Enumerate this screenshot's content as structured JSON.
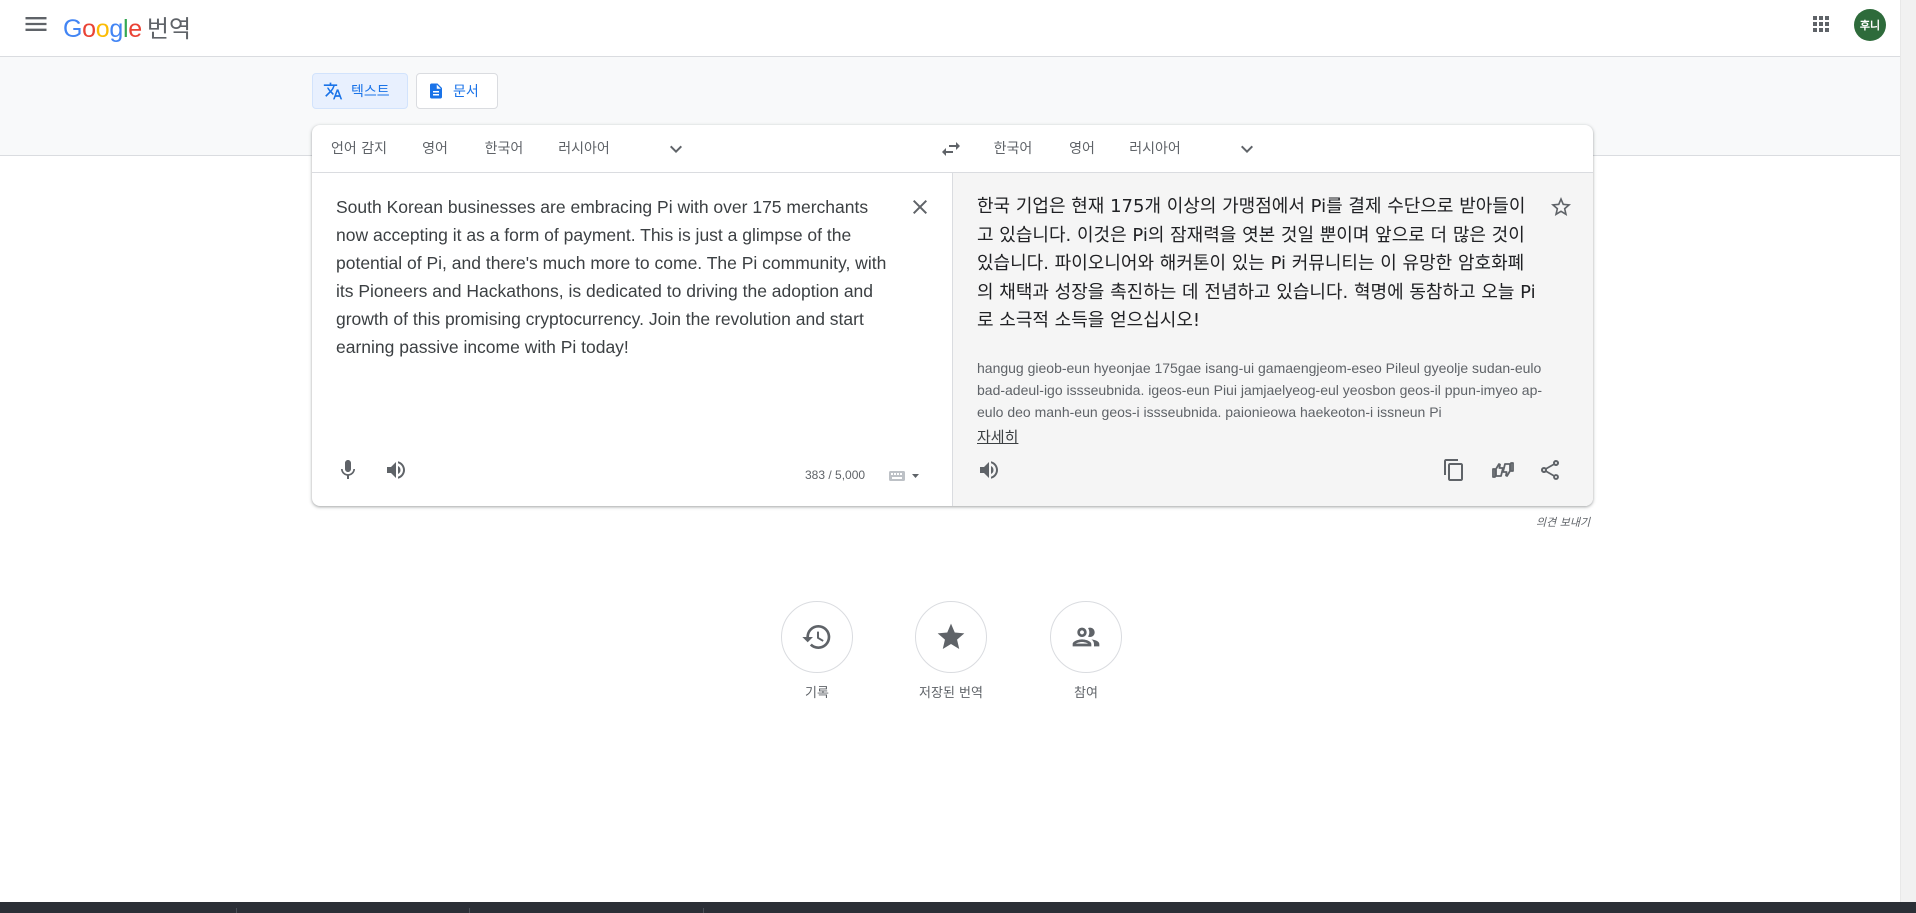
{
  "header": {
    "logo_text": "Google",
    "logo_suffix": "번역",
    "avatar_initials": "후니"
  },
  "modes": {
    "text_label": "텍스트",
    "document_label": "문서"
  },
  "source_languages": [
    "언어 감지",
    "영어",
    "한국어",
    "러시아어"
  ],
  "source_active_index": 1,
  "target_languages": [
    "한국어",
    "영어",
    "러시아어"
  ],
  "target_active_index": 0,
  "source": {
    "text": "South Korean businesses are embracing Pi with over 175 merchants now accepting it as a form of payment. This is just a glimpse of the potential of Pi, and there's much more to come. The Pi community, with its Pioneers and Hackathons, is dedicated to driving the adoption and growth of this promising cryptocurrency. Join the revolution and start earning passive income with Pi today!",
    "char_count": "383 / 5,000"
  },
  "target": {
    "text": "한국 기업은 현재 175개 이상의 가맹점에서 Pi를 결제 수단으로 받아들이고 있습니다. 이것은 Pi의 잠재력을 엿본 것일 뿐이며 앞으로 더 많은 것이 있습니다. 파이오니어와 해커톤이 있는 Pi 커뮤니티는 이 유망한 암호화폐의 채택과 성장을 촉진하는 데 전념하고 있습니다. 혁명에 동참하고 오늘 Pi로 소극적 소득을 얻으십시오!",
    "romanized": "hangug gieob-eun hyeonjae 175gae isang-ui gamaengjeom-eseo Pileul gyeolje sudan-eulo bad-adeul-igo issseubnida. igeos-eun Piui jamjaelyeog-eul yeosbon geos-il ppun-imyeo ap-eulo deo manh-eun geos-i issseubnida. paionieowa haekeoton-i issneun Pi",
    "more_label": "자세히"
  },
  "feedback_label": "의견 보내기",
  "actions": {
    "history_label": "기록",
    "saved_label": "저장된 번역",
    "contribute_label": "참여"
  },
  "colors": {
    "accent": "#1a73e8",
    "avatar_bg": "#2e6b3b",
    "band_bg": "#f8f9fa",
    "target_bg": "#f5f5f5"
  },
  "icons": [
    "menu-icon",
    "apps-grid-icon",
    "translate-icon",
    "document-icon",
    "chevron-down-icon",
    "swap-icon",
    "close-icon",
    "mic-icon",
    "speaker-icon",
    "keyboard-icon",
    "star-icon",
    "copy-icon",
    "thumbs-icon",
    "share-icon",
    "history-icon",
    "people-icon"
  ]
}
